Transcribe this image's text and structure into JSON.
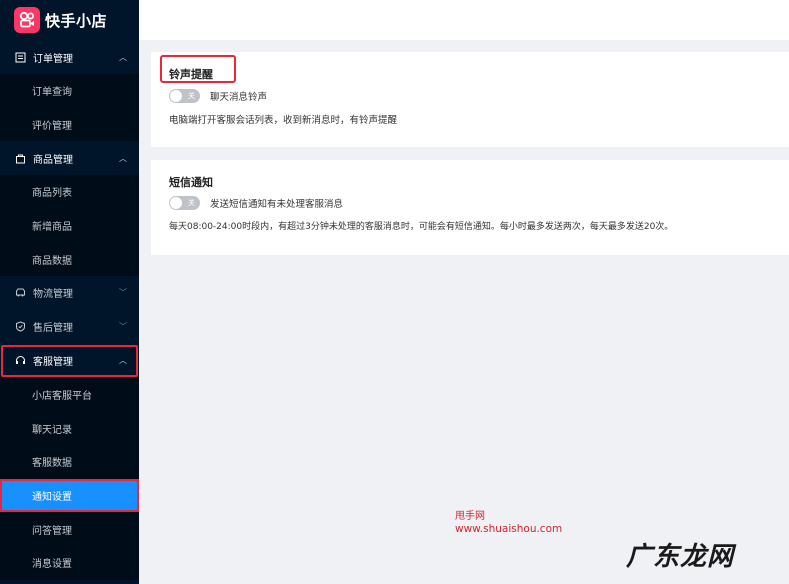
{
  "app": {
    "brand": "快手小店",
    "brand_color": "#fe3666"
  },
  "sidebar": {
    "groups": [
      {
        "label": "订单管理",
        "icon": "order-icon",
        "expanded": true,
        "items": [
          "订单查询",
          "评价管理"
        ]
      },
      {
        "label": "商品管理",
        "icon": "bag-icon",
        "expanded": true,
        "items": [
          "商品列表",
          "新增商品",
          "商品数据"
        ]
      },
      {
        "label": "物流管理",
        "icon": "truck-icon",
        "expanded": false,
        "items": []
      },
      {
        "label": "售后管理",
        "icon": "shield-icon",
        "expanded": false,
        "items": []
      },
      {
        "label": "客服管理",
        "icon": "headset-icon",
        "expanded": true,
        "items": [
          "小店客服平台",
          "聊天记录",
          "客服数据",
          "通知设置",
          "问答管理",
          "消息设置"
        ]
      }
    ],
    "active_item": "通知设置",
    "active_color": "#1890ff"
  },
  "ringtone": {
    "title": "铃声提醒",
    "toggle_state": "关",
    "toggle_label": "聊天消息铃声",
    "description": "电脑端打开客服会话列表，收到新消息时，有铃声提醒"
  },
  "sms": {
    "title": "短信通知",
    "toggle_state": "关",
    "toggle_label": "发送短信通知有未处理客服消息",
    "description": "每天08:00-24:00时段内，有超过3分钟未处理的客服消息时，可能会有短信通知。每小时最多发送两次，每天最多发送20次。"
  },
  "watermark": {
    "line1": "甩手网",
    "line2": "www.shuaishou.com",
    "big": "广东龙网"
  }
}
